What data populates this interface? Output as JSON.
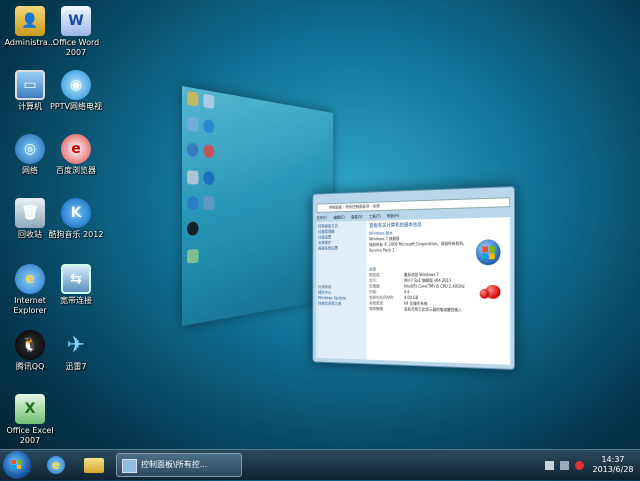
{
  "desktop": {
    "icons": [
      {
        "label": "Administra...",
        "icon": "user-folder-icon"
      },
      {
        "label": "Office Word 2007",
        "icon": "word-icon"
      },
      {
        "label": "计算机",
        "icon": "computer-icon"
      },
      {
        "label": "PPTV网络电视",
        "icon": "pptv-icon"
      },
      {
        "label": "网络",
        "icon": "network-icon"
      },
      {
        "label": "百度浏览器",
        "icon": "browser-icon"
      },
      {
        "label": "回收站",
        "icon": "recycle-bin-icon"
      },
      {
        "label": "酷狗音乐 2012",
        "icon": "kugou-icon"
      },
      {
        "label": "Internet Explorer",
        "icon": "ie-icon"
      },
      {
        "label": "宽带连接",
        "icon": "broadband-icon"
      },
      {
        "label": "腾讯QQ",
        "icon": "qq-icon"
      },
      {
        "label": "迅雷7",
        "icon": "thunder-icon"
      },
      {
        "label": "Office Excel 2007",
        "icon": "excel-icon"
      }
    ]
  },
  "control_panel": {
    "address": "控制面板 › 所有控制面板项 › 系统",
    "menu": [
      "文件(F)",
      "编辑(E)",
      "查看(V)",
      "工具(T)",
      "帮助(H)"
    ],
    "left_links": [
      "控制面板主页",
      "设备管理器",
      "远程设置",
      "系统保护",
      "高级系统设置"
    ],
    "see_also_title": "另请参阅",
    "see_also": [
      "操作中心",
      "Windows Update",
      "性能信息和工具"
    ],
    "heading": "查看有关计算机的基本信息",
    "edition_title": "Windows 版本",
    "edition": "Windows 7 旗舰版",
    "copyright": "版权所有 © 2009 Microsoft Corporation。保留所有权利。",
    "service_pack": "Service Pack 1",
    "system_title": "系统",
    "rows": [
      {
        "k": "制造商:",
        "v": "番茄花园 Windows 7"
      },
      {
        "k": "型号:",
        "v": "Win7 Sp1 旗舰版 x64 2013"
      },
      {
        "k": "处理器:",
        "v": "Intel(R) Core(TM) i5 CPU 2.40GHz"
      },
      {
        "k": "分级:",
        "v": "4.6"
      },
      {
        "k": "安装内存(RAM):",
        "v": "4.00 GB"
      },
      {
        "k": "系统类型:",
        "v": "64 位操作系统"
      },
      {
        "k": "笔和触摸:",
        "v": "没有可用于此显示器的笔或触控输入"
      }
    ]
  },
  "taskbar": {
    "task_label": "控制面板\\所有控...",
    "time": "14:37",
    "date": "2013/6/28"
  },
  "colors": {
    "accent": "#1a4f8a",
    "taskbar": "#0f2433"
  }
}
